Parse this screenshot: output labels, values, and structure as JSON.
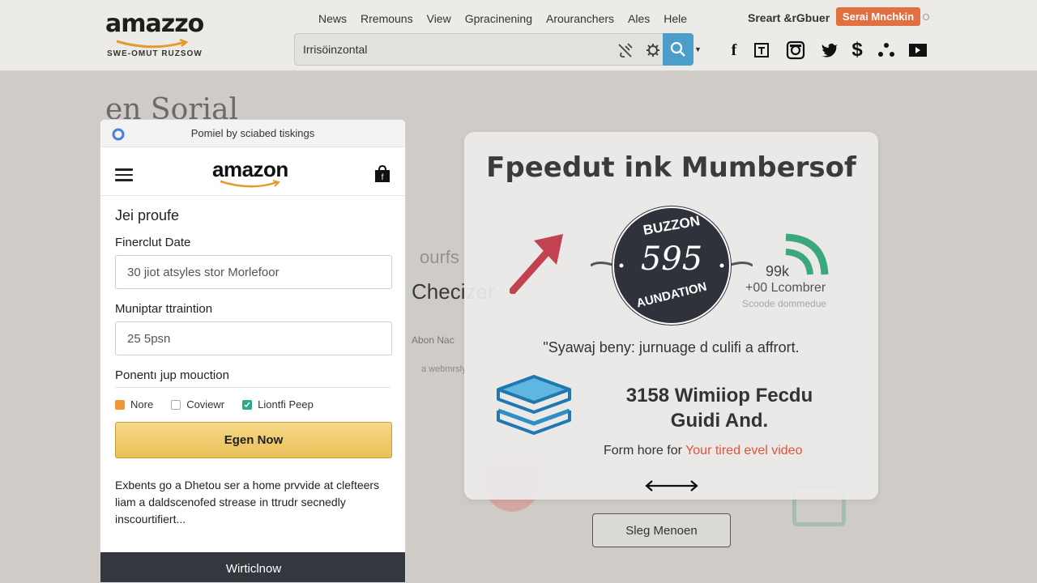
{
  "header": {
    "logo_text": "amazzo",
    "logo_tagline": "SWE-OMUT RUZSOW",
    "nav": [
      "News",
      "Rremouns",
      "View",
      "Gpracinening",
      "Arouranchers",
      "Ales",
      "Hele"
    ],
    "search_value": "Irrisöinzontal",
    "account_link": "Sreart &rGbuer",
    "orange_button": "Serai Mnchkin",
    "social_icons": [
      "facebook-icon",
      "document-icon",
      "instagram-icon",
      "twitter-icon",
      "dollar-icon",
      "dots-icon",
      "video-icon"
    ]
  },
  "background": {
    "title": "en Sorial",
    "our_text": "ourfs",
    "check_text": "Checizer",
    "small1": "Abon Nac",
    "small2": "a webmrsly",
    "button": "Sleg Menoen"
  },
  "mobile": {
    "top_note": "Pomiel by sciabed tiskings",
    "logo": "amazon",
    "section_title": "Jei proufe",
    "label1": "Finerclut Date",
    "input1": "30 jiot atsyles stor Morlefoor",
    "label2": "Muniptar ttraintion",
    "input2": "25 5psn",
    "label3": "Ponentı jup mouction",
    "checks": [
      {
        "label": "Nore",
        "style": "orange"
      },
      {
        "label": "Coviewr",
        "style": "empty"
      },
      {
        "label": "Liontfi Peep",
        "style": "teal"
      }
    ],
    "cta": "Egen Now",
    "paragraph": "Exbents go a Dhetou ser a home prvvide at clefteers liam a daldscenofed strease in ttrudr secnedly inscourtifiert...",
    "footer": "Wirticlnow"
  },
  "card": {
    "title": "Fpeedut ink Mumbersof",
    "badge_top": "BUZZON",
    "badge_num": "595",
    "badge_bottom": "AUNDATION",
    "side_number": "99k",
    "side_sub": "+00 Lcombrer",
    "side_sub2": "Scoode dommedue",
    "quote": "\"Syawaj beny: jurnuage d culifi a affrort.",
    "heading_line1": "3158 Wimiiop Fecdu",
    "heading_line2": "Guidi And.",
    "sub_prefix": "Form hore for ",
    "sub_link": "Your tired evel video"
  },
  "colors": {
    "accent_orange": "#e0703f",
    "search_blue": "#4b9ec9",
    "cta_yellow": "#eac058",
    "badge_dark": "#2f323a",
    "arrow_red": "#c2434f",
    "wifi_green": "#3aa77f",
    "books_blue": "#2e8fc5",
    "footer_dark": "#34383e"
  }
}
